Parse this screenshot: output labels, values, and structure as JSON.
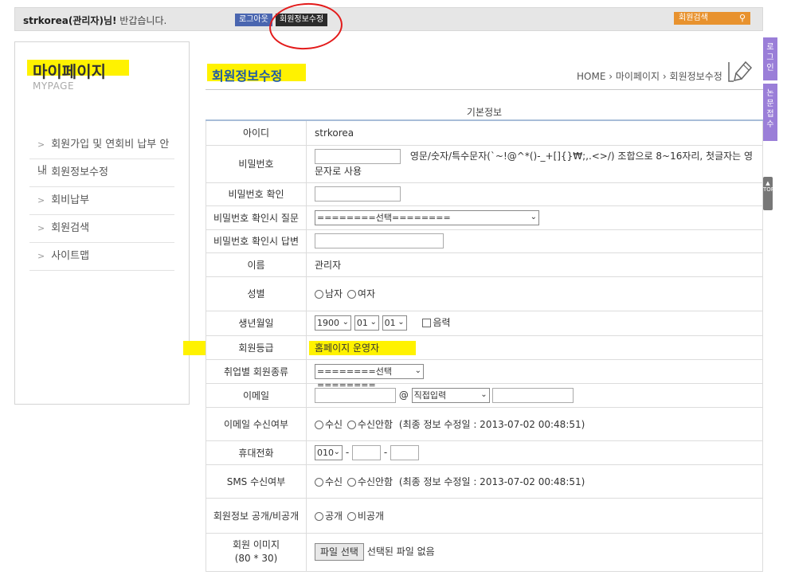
{
  "topbar": {
    "user": "strkorea(관리자)님!",
    "greeting": " 반갑습니다.",
    "logout_label": "로그아웃",
    "modify_label": "회원정보수정",
    "member_search_label": "회원검색",
    "member_search_icon": "person-search-icon"
  },
  "side_tabs": {
    "login": "로그인",
    "paper_submit": "논문접수",
    "top": "TOP"
  },
  "sidebar": {
    "title": "마이페이지",
    "subtitle": "MYPAGE",
    "items": [
      {
        "label": "회원가입 및 연회비 납부 안내"
      },
      {
        "label": "회원정보수정"
      },
      {
        "label": "회비납부"
      },
      {
        "label": "회원검색"
      },
      {
        "label": "사이트맵"
      }
    ]
  },
  "main": {
    "title": "회원정보수정",
    "breadcrumb": {
      "home": "HOME",
      "sep": "›",
      "mypage": "마이페이지",
      "current": "회원정보수정"
    },
    "section_caption": "기본정보"
  },
  "form": {
    "id_label": "아이디",
    "id_value": "strkorea",
    "password_label": "비밀번호",
    "password_hint": "영문/숫자/특수문자(`~!@^*()-_+[]{}₩;,.<>/) 조합으로 8~16자리, 첫글자는 영문자로 사용",
    "password_confirm_label": "비밀번호 확인",
    "question_label": "비밀번호 확인시 질문",
    "question_value": "========선택========",
    "answer_label": "비밀번호 확인시 답변",
    "name_label": "이름",
    "name_value": "관리자",
    "gender_label": "성별",
    "gender_options": [
      "남자",
      "여자"
    ],
    "birth_label": "생년월일",
    "birth_year": "1900",
    "birth_month": "01",
    "birth_day": "01",
    "lunar_label": "음력",
    "grade_label": "회원등급",
    "grade_value": "홈페이지 운영자",
    "job_type_label": "취업별 회원종류",
    "job_type_value": "========선택========",
    "email_label": "이메일",
    "email_at": "@",
    "email_domain_value": "직접입력",
    "email_receive_label": "이메일 수신여부",
    "receive_options": [
      "수신",
      "수신안함"
    ],
    "email_last_modified": "(최종 정보 수정일 : 2013-07-02 00:48:51)",
    "phone_label": "휴대전화",
    "phone_prefix": "010",
    "phone_dash": "-",
    "sms_receive_label": "SMS 수신여부",
    "sms_last_modified": "(최종 정보 수정일 : 2013-07-02 00:48:51)",
    "public_label": "회원정보 공개/비공개",
    "public_options": [
      "공개",
      "비공개"
    ],
    "image_label": "회원 이미지",
    "image_size": "(80 * 30)",
    "file_button": "파일 선택",
    "file_status": "선택된 파일 없음"
  },
  "colors": {
    "highlight": "#fff200",
    "annotation_circle": "#e31b1b",
    "title_blue": "#1d5aa6",
    "side_tab_purple": "#9a7ed8",
    "member_search_orange": "#e8922e"
  }
}
